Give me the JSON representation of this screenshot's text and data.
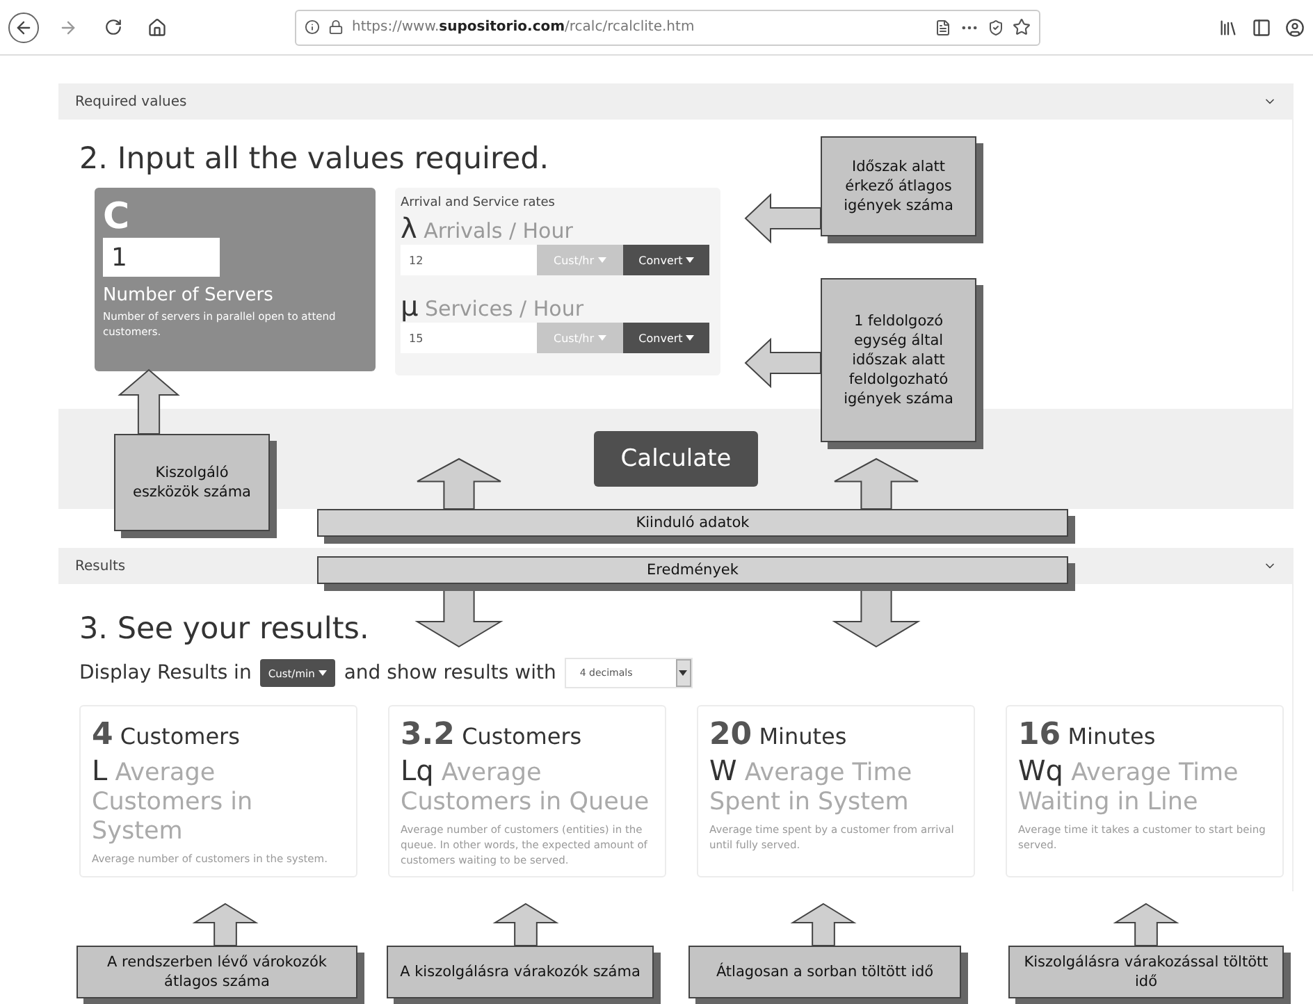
{
  "browser": {
    "url": "https://www.**supositorio.com**/rcalc/rcalclite.htm"
  },
  "input_panel": {
    "header": "Required values",
    "heading": "2. Input all the values required.",
    "servers": {
      "symbol": "C",
      "value": "1",
      "label": "Number of Servers",
      "description": "Number of servers in parallel open to attend customers."
    },
    "rates": {
      "title": "Arrival and Service rates",
      "items": [
        {
          "symbol": "λ",
          "label": "Arrivals / Hour",
          "value": "12",
          "unit": "Cust/hr",
          "convert": "Convert"
        },
        {
          "symbol": "μ",
          "label": "Services / Hour",
          "value": "15",
          "unit": "Cust/hr",
          "convert": "Convert"
        }
      ]
    },
    "calculate": "Calculate"
  },
  "results_panel": {
    "header": "Results",
    "heading": "3. See your results.",
    "display_label": "Display Results in",
    "unit": "Cust/min",
    "show_label": "and show results with",
    "decimals": "4 decimals",
    "cards": [
      {
        "value": "4",
        "unit": "Customers",
        "symbol": "L",
        "title": "Average Customers in System",
        "description": "Average number of customers in the system."
      },
      {
        "value": "3.2",
        "unit": "Customers",
        "symbol": "Lq",
        "title": "Average Customers in Queue",
        "description": "Average number of customers (entities) in the queue. In other words, the expected amount of customers waiting to be served."
      },
      {
        "value": "20",
        "unit": "Minutes",
        "symbol": "W",
        "title": "Average Time Spent in System",
        "description": "Average time spent by a customer from arrival until fully served."
      },
      {
        "value": "16",
        "unit": "Minutes",
        "symbol": "Wq",
        "title": "Average Time Waiting in Line",
        "description": "Average time it takes a customer to start being served."
      }
    ]
  },
  "annotations": {
    "callouts": [
      "Időszak alatt érkező átlagos igények száma",
      "1 feldolgozó egység által időszak alatt feldolgozható igények száma",
      "Kiszolgáló eszközök száma",
      "A rendszerben lévő várokozók átlagos száma",
      "A kiszolgálásra várakozók száma",
      "Átlagosan a sorban töltött idő",
      "Kiszolgálásra várakozással töltött idő"
    ],
    "banners": [
      "Kiinduló adatok",
      "Eredmények"
    ]
  }
}
